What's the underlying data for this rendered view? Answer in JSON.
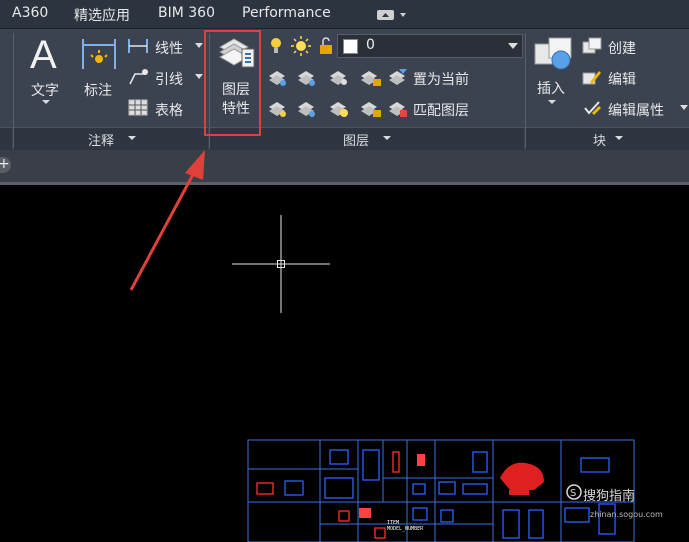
{
  "top_tabs": [
    {
      "label": "A360"
    },
    {
      "label": "精选应用"
    },
    {
      "label": "BIM 360"
    },
    {
      "label": "Performance"
    }
  ],
  "annotate_panel": {
    "text_btn": "文字",
    "dim_btn": "标注",
    "linear": "线性",
    "leader": "引线",
    "table": "表格",
    "footer": "注释"
  },
  "layer_panel": {
    "properties_line1": "图层",
    "properties_line2": "特性",
    "current_layer": "0",
    "set_current": "置为当前",
    "match_layer": "匹配图层",
    "footer": "图层"
  },
  "block_panel": {
    "insert": "插入",
    "create": "创建",
    "edit": "编辑",
    "edit_attr": "编辑属性",
    "footer": "块"
  },
  "doc_tab_plus": "+",
  "watermark": {
    "text": "搜狗指南",
    "sub": "zhinan.sogou.com"
  },
  "drawing_labels": {
    "item": "ITEM",
    "model_number": "MODEL_NUMBER"
  }
}
